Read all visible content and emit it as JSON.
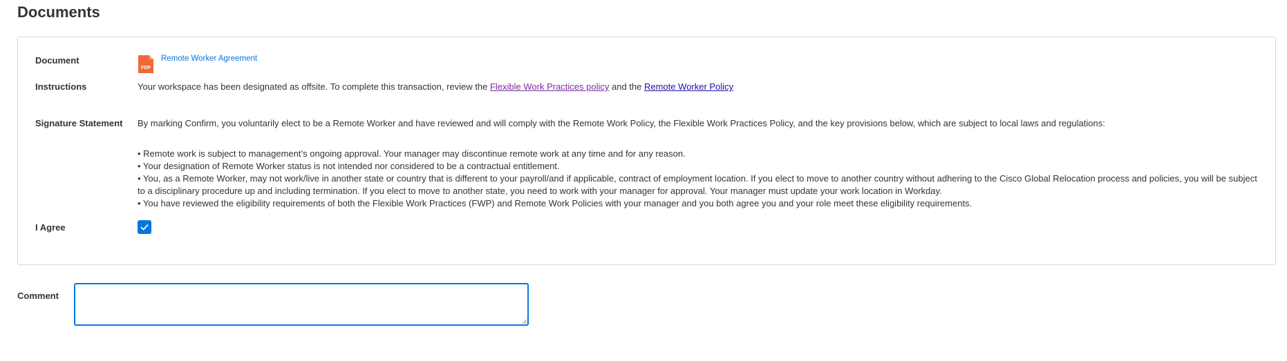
{
  "page": {
    "title": "Documents"
  },
  "form": {
    "document_label": "Document",
    "document_icon": "pdf-icon",
    "document_link": "Remote Worker Agreement",
    "instructions_label": "Instructions",
    "instructions_text_1": "Your workspace has been designated as offsite.  To complete this transaction, review the ",
    "instructions_link_1": "Flexible Work Practices policy",
    "instructions_text_2": " and the ",
    "instructions_link_2": "Remote Worker Policy",
    "signature_label": "Signature Statement",
    "signature_intro": "By marking Confirm, you voluntarily elect to be a Remote Worker and have reviewed and will comply with the Remote Work Policy, the Flexible Work Practices Policy, and the key provisions below, which are subject to local laws and regulations:",
    "bullets": [
      "• Remote work is subject to management’s ongoing approval. Your manager may discontinue remote work at any time and for any reason.",
      "• Your designation of Remote Worker status is not intended nor considered to be a contractual entitlement.",
      "• You, as a Remote Worker, may not work/live in another state or country that is different to your payroll/and if applicable, contract of employment location. If you elect to move to another country without adhering to the Cisco Global Relocation process and policies, you will be subject to a disciplinary procedure up and including termination. If you elect to move to another state, you need to work with your manager for approval. Your manager must update your work location in Workday.",
      "• You have reviewed the eligibility requirements of both the Flexible Work Practices (FWP) and Remote Work Policies with your manager and you both agree you and your role meet these eligibility requirements."
    ],
    "agree_label": "I Agree",
    "agree_checked": true
  },
  "comment": {
    "label": "Comment",
    "value": ""
  },
  "colors": {
    "accent": "#0875e1",
    "visited_link": "#7b2c9e",
    "link": "#1a0dab",
    "pdf_icon": "#f06a35"
  }
}
